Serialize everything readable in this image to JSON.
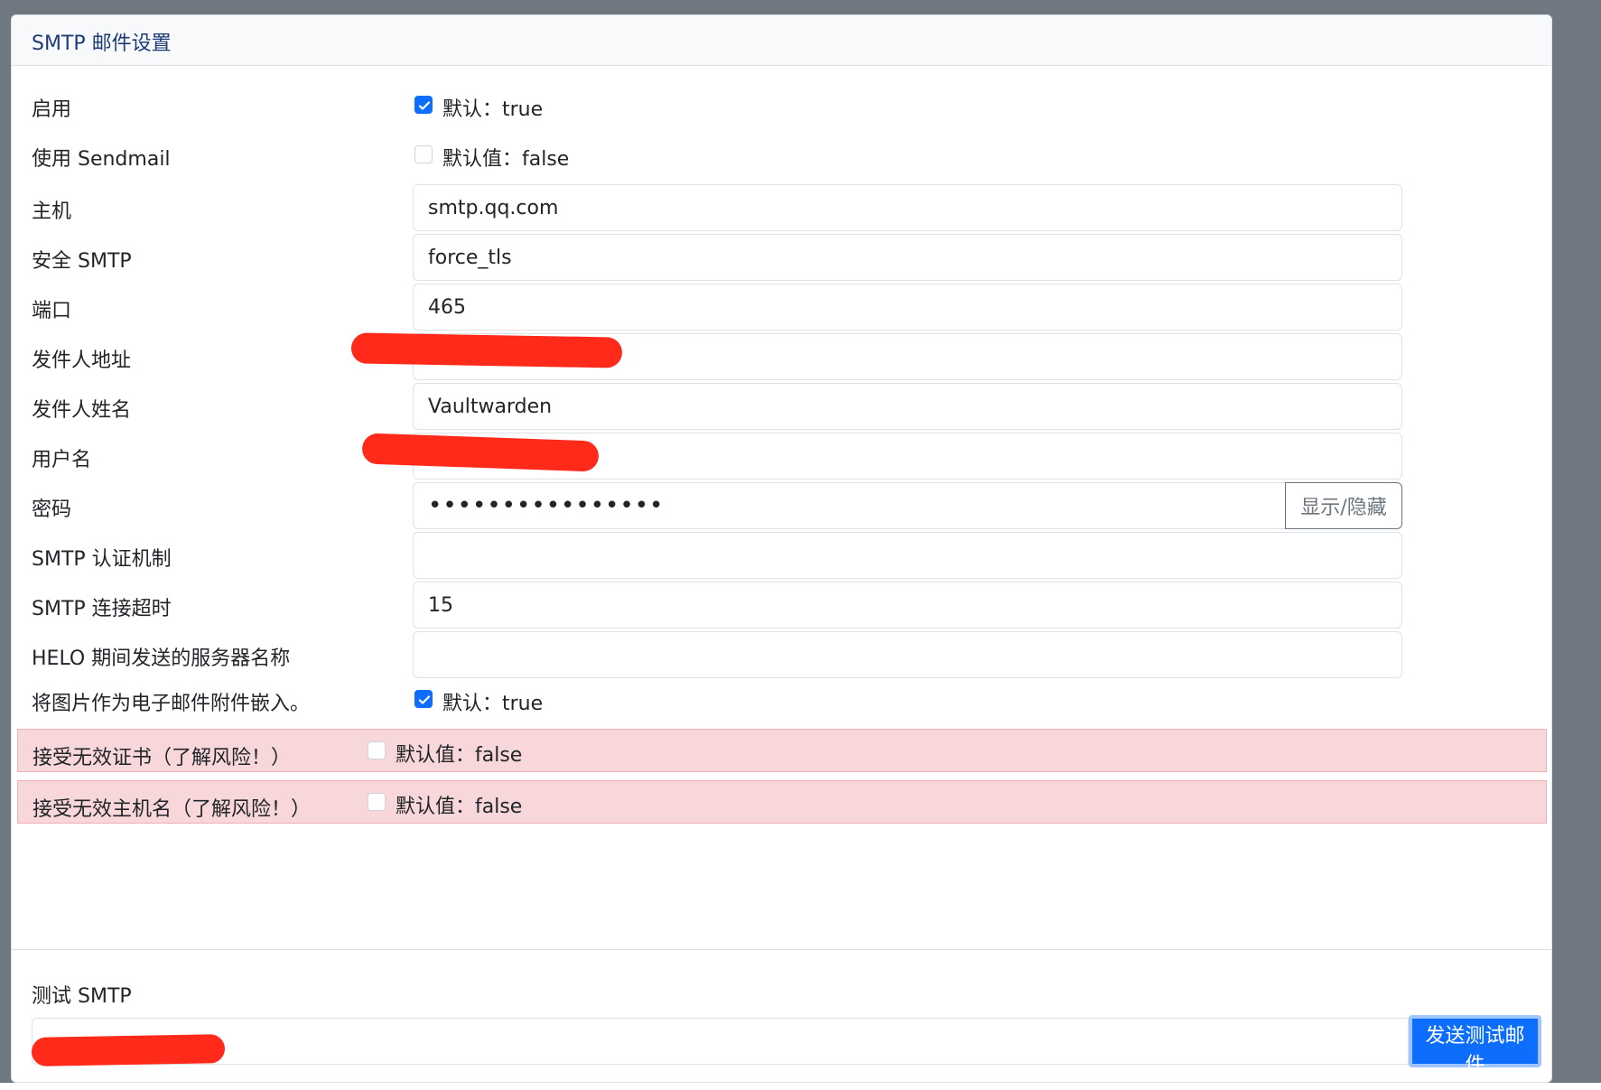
{
  "card": {
    "title": "SMTP 邮件设置"
  },
  "colors": {
    "primary": "#0d6efd",
    "warning_row": "#f8d7da",
    "redaction": "#ff2a1a"
  },
  "fields": {
    "enabled": {
      "label": "启用",
      "checked": true,
      "hint": "默认：true"
    },
    "use_sendmail": {
      "label": "使用 Sendmail",
      "checked": false,
      "hint": "默认值：false"
    },
    "host": {
      "label": "主机",
      "value": "smtp.qq.com"
    },
    "security": {
      "label": "安全 SMTP",
      "value": "force_tls"
    },
    "port": {
      "label": "端口",
      "value": "465"
    },
    "from_address": {
      "label": "发件人地址",
      "value": ""
    },
    "from_name": {
      "label": "发件人姓名",
      "value": "Vaultwarden"
    },
    "username": {
      "label": "用户名",
      "value": ""
    },
    "password": {
      "label": "密码",
      "value": "••••••••••••••••",
      "toggle_label": "显示/隐藏"
    },
    "auth_mechanism": {
      "label": "SMTP 认证机制",
      "value": ""
    },
    "timeout": {
      "label": "SMTP 连接超时",
      "value": "15"
    },
    "helo_name": {
      "label": "HELO 期间发送的服务器名称",
      "value": ""
    },
    "embed_images": {
      "label": "将图片作为电子邮件附件嵌入。",
      "checked": true,
      "hint": "默认：true"
    },
    "accept_invalid_certs": {
      "label": "接受无效证书（了解风险！）",
      "checked": false,
      "hint": "默认值：false"
    },
    "accept_invalid_hostnames": {
      "label": "接受无效主机名（了解风险！）",
      "checked": false,
      "hint": "默认值：false"
    }
  },
  "test": {
    "label": "测试 SMTP",
    "value": "",
    "button_label": "发送测试邮件"
  }
}
